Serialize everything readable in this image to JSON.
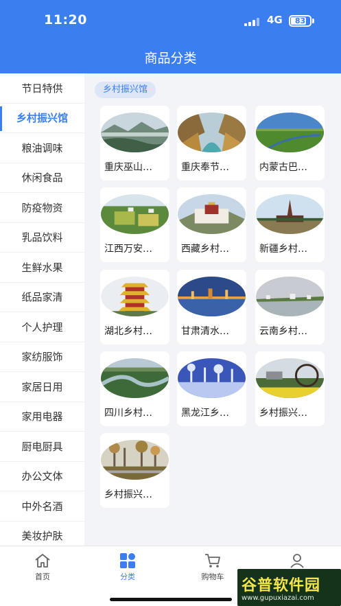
{
  "status_bar": {
    "time": "11:20",
    "network": "4G",
    "battery": "83",
    "battery_fraction": 0.83
  },
  "header": {
    "title": "商品分类"
  },
  "sidebar": {
    "items": [
      {
        "label": "节日特供"
      },
      {
        "label": "乡村振兴馆",
        "active": true
      },
      {
        "label": "粮油调味"
      },
      {
        "label": "休闲食品"
      },
      {
        "label": "防疫物资"
      },
      {
        "label": "乳品饮料"
      },
      {
        "label": "生鲜水果"
      },
      {
        "label": "纸品家清"
      },
      {
        "label": "个人护理"
      },
      {
        "label": "家纺服饰"
      },
      {
        "label": "家居日用"
      },
      {
        "label": "家用电器"
      },
      {
        "label": "厨电厨具"
      },
      {
        "label": "办公文体"
      },
      {
        "label": "中外名酒"
      },
      {
        "label": "美妆护肤"
      }
    ]
  },
  "main": {
    "category_tag": "乡村振兴馆",
    "subcategories": [
      {
        "label": "重庆巫山…",
        "scene": "mountain-fog"
      },
      {
        "label": "重庆奉节…",
        "scene": "river-gorge"
      },
      {
        "label": "内蒙古巴…",
        "scene": "grassland"
      },
      {
        "label": "江西万安…",
        "scene": "village-fields"
      },
      {
        "label": "西藏乡村…",
        "scene": "potala-palace"
      },
      {
        "label": "新疆乡村…",
        "scene": "desert-tower"
      },
      {
        "label": "湖北乡村…",
        "scene": "yellow-crane-tower"
      },
      {
        "label": "甘肃清水…",
        "scene": "night-lake"
      },
      {
        "label": "云南乡村…",
        "scene": "lake-town"
      },
      {
        "label": "四川乡村…",
        "scene": "river-bend"
      },
      {
        "label": "黑龙江乡…",
        "scene": "winter-frost"
      },
      {
        "label": "乡村振兴…",
        "scene": "waterwheel-flowers"
      },
      {
        "label": "乡村振兴…",
        "scene": "autumn-forest"
      }
    ]
  },
  "tabbar": {
    "tabs": [
      {
        "label": "首页",
        "icon": "home-icon"
      },
      {
        "label": "分类",
        "icon": "category-grid-icon",
        "active": true
      },
      {
        "label": "购物车",
        "icon": "cart-icon"
      },
      {
        "label": "我的",
        "icon": "user-icon"
      }
    ]
  },
  "watermark": {
    "main": "谷普软件园",
    "url": "www.gupuxiazai.com"
  },
  "colors": {
    "accent": "#3a7ef0",
    "main_bg": "#f3f4f7",
    "tag_bg": "#dde6f6"
  }
}
